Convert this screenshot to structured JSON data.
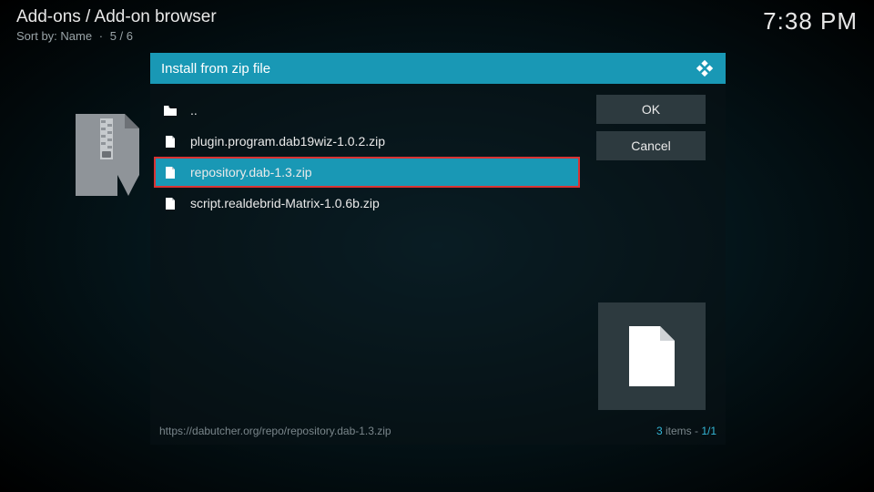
{
  "header": {
    "breadcrumb": "Add-ons / Add-on browser",
    "sort_label": "Sort by: Name",
    "sort_sep": "·",
    "sort_pos": "5 / 6",
    "clock": "7:38 PM"
  },
  "dialog": {
    "title": "Install from zip file",
    "buttons": {
      "ok": "OK",
      "cancel": "Cancel"
    },
    "files": [
      {
        "icon": "folder",
        "name": ".."
      },
      {
        "icon": "file",
        "name": "plugin.program.dab19wiz-1.0.2.zip"
      },
      {
        "icon": "file",
        "name": "repository.dab-1.3.zip",
        "selected": true,
        "highlighted": true
      },
      {
        "icon": "file",
        "name": "script.realdebrid-Matrix-1.0.6b.zip"
      }
    ],
    "footer": {
      "path": "https://dabutcher.org/repo/repository.dab-1.3.zip",
      "count_num": "3",
      "count_label": " items - ",
      "count_page": "1/1"
    }
  }
}
